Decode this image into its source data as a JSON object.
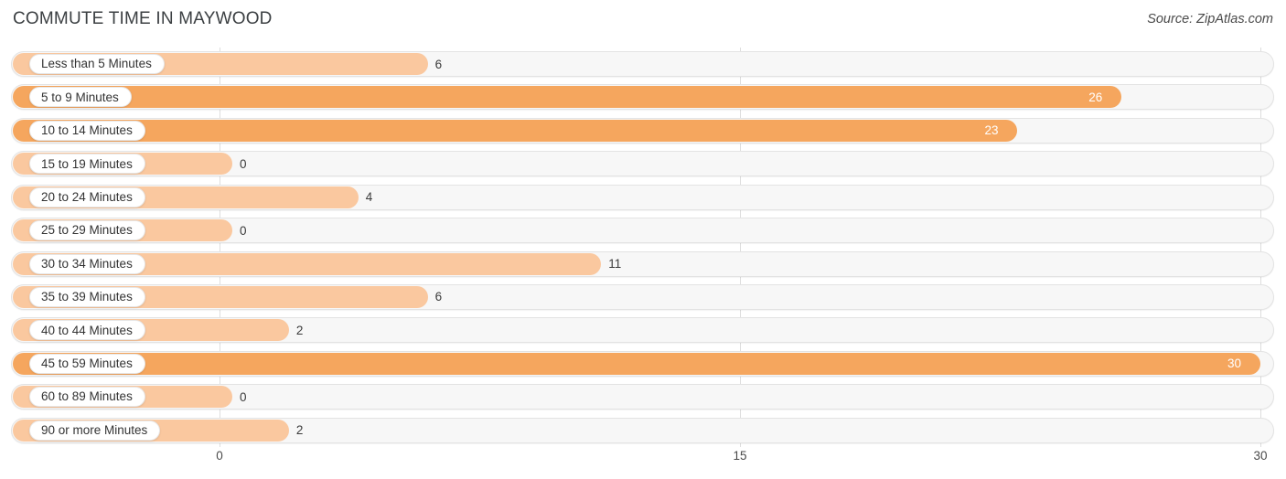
{
  "header": {
    "title": "COMMUTE TIME IN MAYWOOD",
    "source": "Source: ZipAtlas.com"
  },
  "theme": {
    "bar_solid": "#f5a65e",
    "bar_light": "#fac89f",
    "track_bg": "#f7f7f7",
    "track_border": "#e3e3e3",
    "gridline": "#dddddd",
    "label_text": "#333333",
    "value_text_outside": "#3a3a3a",
    "value_text_inside": "#ffffff"
  },
  "axis": {
    "ticks": [
      "0",
      "15",
      "30"
    ],
    "min": 0,
    "max": 30
  },
  "chart_data": {
    "type": "bar",
    "orientation": "horizontal",
    "title": "COMMUTE TIME IN MAYWOOD",
    "subtitle": "Source: ZipAtlas.com",
    "xlabel": "",
    "ylabel": "",
    "xlim": [
      0,
      30
    ],
    "xticks": [
      0,
      15,
      30
    ],
    "grid": true,
    "legend": "none",
    "categories": [
      "Less than 5 Minutes",
      "5 to 9 Minutes",
      "10 to 14 Minutes",
      "15 to 19 Minutes",
      "20 to 24 Minutes",
      "25 to 29 Minutes",
      "30 to 34 Minutes",
      "35 to 39 Minutes",
      "40 to 44 Minutes",
      "45 to 59 Minutes",
      "60 to 89 Minutes",
      "90 or more Minutes"
    ],
    "values": [
      6,
      26,
      23,
      0,
      4,
      0,
      11,
      6,
      2,
      30,
      0,
      2
    ],
    "value_labels": [
      "6",
      "26",
      "23",
      "0",
      "4",
      "0",
      "11",
      "6",
      "2",
      "30",
      "0",
      "2"
    ]
  },
  "rows": [
    {
      "label": "Less than 5 Minutes",
      "value": 6,
      "value_label": "6",
      "style": "light",
      "label_position": "outside"
    },
    {
      "label": "5 to 9 Minutes",
      "value": 26,
      "value_label": "26",
      "style": "solid",
      "label_position": "inside"
    },
    {
      "label": "10 to 14 Minutes",
      "value": 23,
      "value_label": "23",
      "style": "solid",
      "label_position": "inside"
    },
    {
      "label": "15 to 19 Minutes",
      "value": 0,
      "value_label": "0",
      "style": "light",
      "label_position": "outside"
    },
    {
      "label": "20 to 24 Minutes",
      "value": 4,
      "value_label": "4",
      "style": "light",
      "label_position": "outside"
    },
    {
      "label": "25 to 29 Minutes",
      "value": 0,
      "value_label": "0",
      "style": "light",
      "label_position": "outside"
    },
    {
      "label": "30 to 34 Minutes",
      "value": 11,
      "value_label": "11",
      "style": "light",
      "label_position": "outside"
    },
    {
      "label": "35 to 39 Minutes",
      "value": 6,
      "value_label": "6",
      "style": "light",
      "label_position": "outside"
    },
    {
      "label": "40 to 44 Minutes",
      "value": 2,
      "value_label": "2",
      "style": "light",
      "label_position": "outside"
    },
    {
      "label": "45 to 59 Minutes",
      "value": 30,
      "value_label": "30",
      "style": "solid",
      "label_position": "inside"
    },
    {
      "label": "60 to 89 Minutes",
      "value": 0,
      "value_label": "0",
      "style": "light",
      "label_position": "outside"
    },
    {
      "label": "90 or more Minutes",
      "value": 2,
      "value_label": "2",
      "style": "light",
      "label_position": "outside"
    }
  ]
}
